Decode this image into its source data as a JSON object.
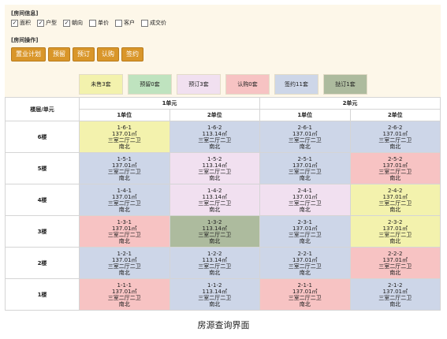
{
  "info": {
    "title": "[房间信息]",
    "checks": [
      {
        "label": "面积",
        "checked": true
      },
      {
        "label": "户型",
        "checked": true
      },
      {
        "label": "朝向",
        "checked": true
      },
      {
        "label": "单价",
        "checked": false
      },
      {
        "label": "客户",
        "checked": false
      },
      {
        "label": "成交价",
        "checked": false
      }
    ]
  },
  "ops": {
    "title": "[房间操作]",
    "buttons": [
      "置业计划",
      "预留",
      "预订",
      "认购",
      "签约"
    ]
  },
  "legend": [
    {
      "label": "未售3套",
      "color": "#f3f2ad"
    },
    {
      "label": "预留0套",
      "color": "#bfe3bf"
    },
    {
      "label": "预订3套",
      "color": "#f1e0f0"
    },
    {
      "label": "认购0套",
      "color": "#f7c3c3"
    },
    {
      "label": "签约11套",
      "color": "#cdd6e8"
    },
    {
      "label": "挞订1套",
      "color": "#adbb9e"
    }
  ],
  "table": {
    "corner": "楼层/单元",
    "units": [
      "1单元",
      "2单元"
    ],
    "positions": [
      "1单位",
      "2单位",
      "1单位",
      "2单位"
    ],
    "rows": [
      {
        "floor": "6楼",
        "cells": [
          {
            "id": "1-6-1",
            "area": "137.01㎡",
            "type": "三室二厅二卫",
            "dir": "南北",
            "status": "未售"
          },
          {
            "id": "1-6-2",
            "area": "113.14㎡",
            "type": "三室二厅二卫",
            "dir": "南北",
            "status": "签约"
          },
          {
            "id": "2-6-1",
            "area": "137.01㎡",
            "type": "三室二厅二卫",
            "dir": "南北",
            "status": "签约"
          },
          {
            "id": "2-6-2",
            "area": "137.01㎡",
            "type": "三室二厅二卫",
            "dir": "南北",
            "status": "签约"
          }
        ]
      },
      {
        "floor": "5楼",
        "cells": [
          {
            "id": "1-5-1",
            "area": "137.01㎡",
            "type": "三室二厅二卫",
            "dir": "南北",
            "status": "签约"
          },
          {
            "id": "1-5-2",
            "area": "113.14㎡",
            "type": "三室二厅二卫",
            "dir": "南北",
            "status": "预订"
          },
          {
            "id": "2-5-1",
            "area": "137.01㎡",
            "type": "三室二厅二卫",
            "dir": "南北",
            "status": "签约"
          },
          {
            "id": "2-5-2",
            "area": "137.01㎡",
            "type": "三室二厅二卫",
            "dir": "南北",
            "status": "认购"
          }
        ]
      },
      {
        "floor": "4楼",
        "cells": [
          {
            "id": "1-4-1",
            "area": "137.01㎡",
            "type": "三室二厅二卫",
            "dir": "南北",
            "status": "签约"
          },
          {
            "id": "1-4-2",
            "area": "113.14㎡",
            "type": "三室二厅二卫",
            "dir": "南北",
            "status": "预订"
          },
          {
            "id": "2-4-1",
            "area": "137.01㎡",
            "type": "三室二厅二卫",
            "dir": "南北",
            "status": "预订"
          },
          {
            "id": "2-4-2",
            "area": "137.01㎡",
            "type": "三室二厅二卫",
            "dir": "南北",
            "status": "未售"
          }
        ]
      },
      {
        "floor": "3楼",
        "cells": [
          {
            "id": "1-3-1",
            "area": "137.01㎡",
            "type": "三室二厅二卫",
            "dir": "南北",
            "status": "认购"
          },
          {
            "id": "1-3-2",
            "area": "113.14㎡",
            "type": "三室二厅二卫",
            "dir": "南北",
            "status": "挞订"
          },
          {
            "id": "2-3-1",
            "area": "137.01㎡",
            "type": "三室二厅二卫",
            "dir": "南北",
            "status": "签约"
          },
          {
            "id": "2-3-2",
            "area": "137.01㎡",
            "type": "三室二厅二卫",
            "dir": "南北",
            "status": "未售"
          }
        ]
      },
      {
        "floor": "2楼",
        "cells": [
          {
            "id": "1-2-1",
            "area": "137.01㎡",
            "type": "三室二厅二卫",
            "dir": "南北",
            "status": "签约"
          },
          {
            "id": "1-2-2",
            "area": "113.14㎡",
            "type": "三室二厅二卫",
            "dir": "南北",
            "status": "签约"
          },
          {
            "id": "2-2-1",
            "area": "137.01㎡",
            "type": "三室二厅二卫",
            "dir": "南北",
            "status": "签约"
          },
          {
            "id": "2-2-2",
            "area": "137.01㎡",
            "type": "三室二厅二卫",
            "dir": "南北",
            "status": "认购"
          }
        ]
      },
      {
        "floor": "1楼",
        "cells": [
          {
            "id": "1-1-1",
            "area": "137.01㎡",
            "type": "三室二厅二卫",
            "dir": "南北",
            "status": "认购"
          },
          {
            "id": "1-1-2",
            "area": "113.14㎡",
            "type": "三室二厅二卫",
            "dir": "南北",
            "status": "签约"
          },
          {
            "id": "2-1-1",
            "area": "137.01㎡",
            "type": "三室二厅二卫",
            "dir": "南北",
            "status": "认购"
          },
          {
            "id": "2-1-2",
            "area": "137.01㎡",
            "type": "三室二厅二卫",
            "dir": "南北",
            "status": "签约"
          }
        ]
      }
    ]
  },
  "status_colors": {
    "未售": "#f3f2ad",
    "预留": "#bfe3bf",
    "预订": "#f1e0f0",
    "认购": "#f7c3c3",
    "签约": "#cdd6e8",
    "挞订": "#adbb9e"
  },
  "caption": "房源查询界面"
}
